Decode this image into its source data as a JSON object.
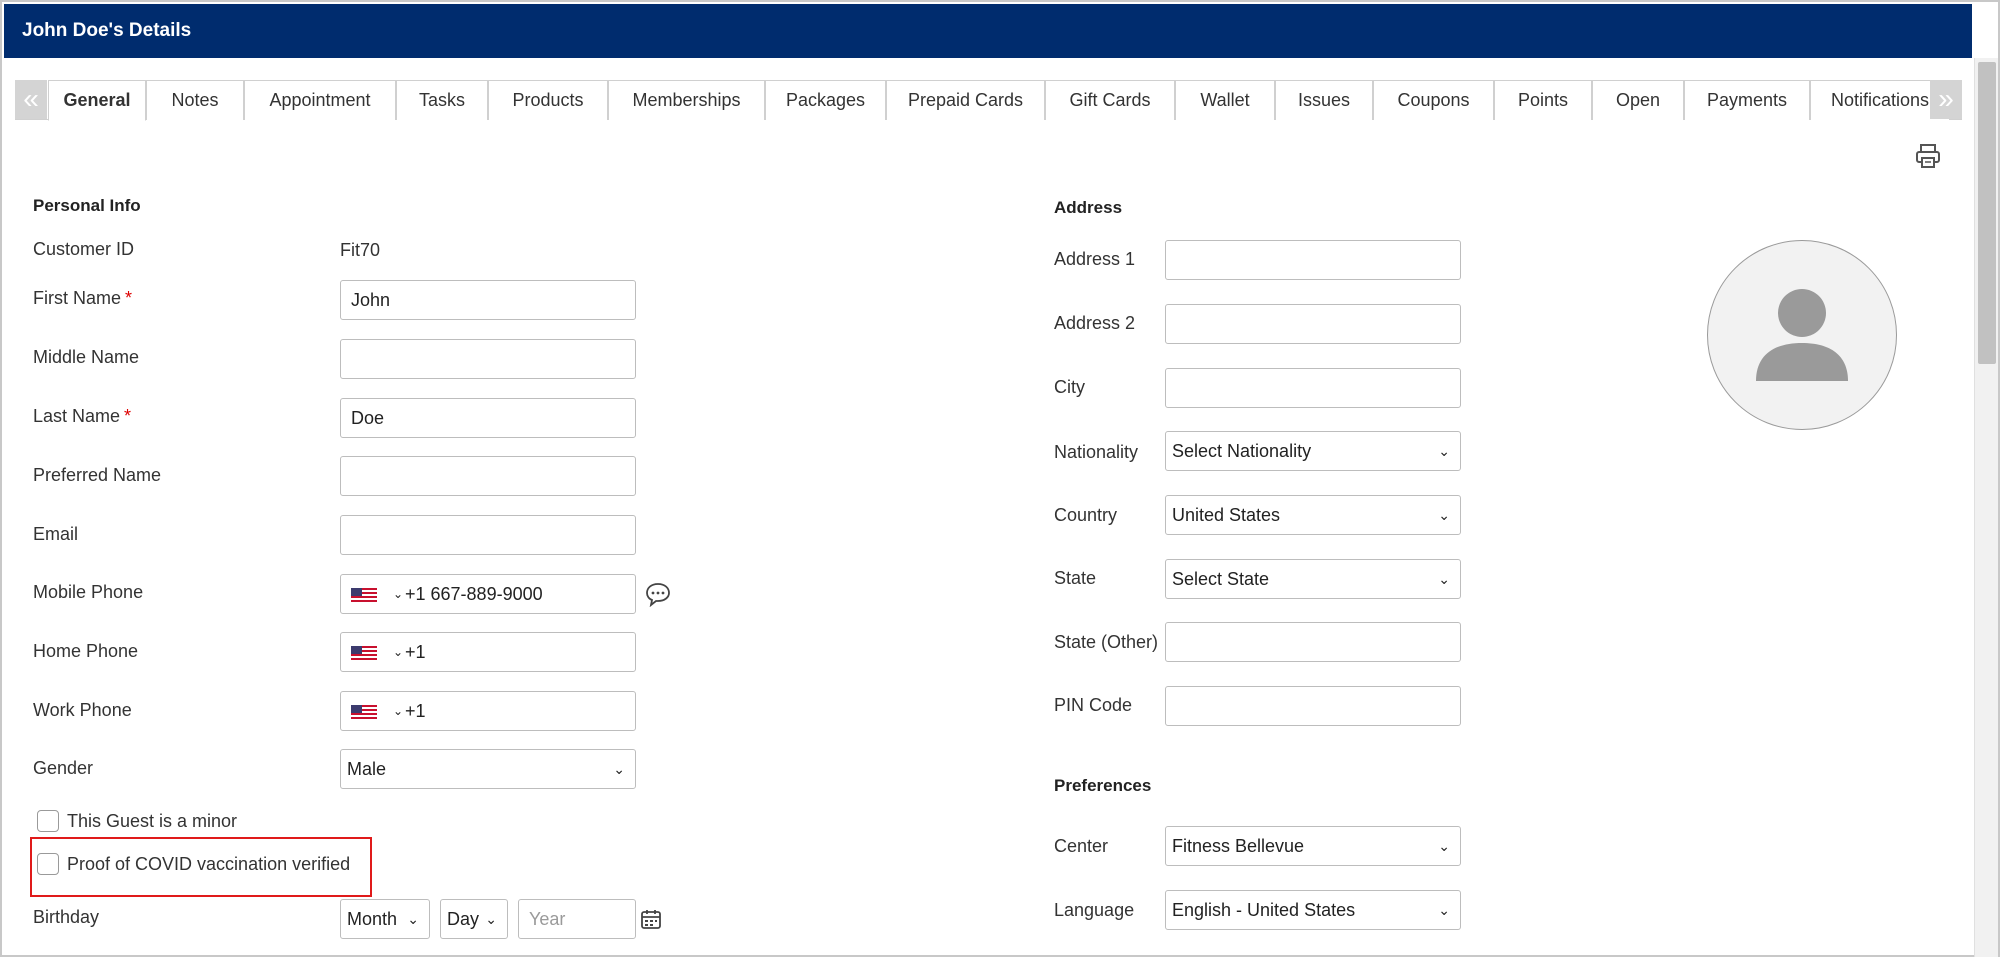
{
  "window": {
    "title": "John Doe's Details"
  },
  "tabs": [
    "General",
    "Notes",
    "Appointment",
    "Tasks",
    "Products",
    "Memberships",
    "Packages",
    "Prepaid Cards",
    "Gift Cards",
    "Wallet",
    "Issues",
    "Coupons",
    "Points",
    "Open",
    "Payments",
    "Notifications"
  ],
  "active_tab": "General",
  "personal": {
    "title": "Personal Info",
    "customer_id_label": "Customer ID",
    "customer_id": "Fit70",
    "first_name_label": "First Name",
    "first_name": "John",
    "middle_name_label": "Middle Name",
    "middle_name": "",
    "last_name_label": "Last Name",
    "last_name": "Doe",
    "preferred_name_label": "Preferred Name",
    "preferred_name": "",
    "email_label": "Email",
    "email": "",
    "mobile_label": "Mobile Phone",
    "mobile": "+1 667-889-9000",
    "home_label": "Home Phone",
    "home": "+1",
    "work_label": "Work Phone",
    "work": "+1",
    "gender_label": "Gender",
    "gender": "Male",
    "minor_label": "This Guest is a minor",
    "covid_label": "Proof of COVID vaccination verified",
    "birthday_label": "Birthday",
    "birthday_month": "Month",
    "birthday_day": "Day",
    "birthday_year_placeholder": "Year",
    "required_mark": "*"
  },
  "address": {
    "title": "Address",
    "address1_label": "Address 1",
    "address2_label": "Address 2",
    "city_label": "City",
    "nationality_label": "Nationality",
    "nationality": "Select Nationality",
    "country_label": "Country",
    "country": "United States",
    "state_label": "State",
    "state": "Select State",
    "state_other_label": "State (Other)",
    "pin_label": "PIN Code"
  },
  "preferences": {
    "title": "Preferences",
    "center_label": "Center",
    "center": "Fitness Bellevue",
    "language_label": "Language",
    "language": "English - United States"
  },
  "colors": {
    "titlebar": "#002c6e",
    "highlight": "#e01a1a",
    "required": "#d00000"
  },
  "icons": [
    "chevrons-left-icon",
    "chevrons-right-icon",
    "printer-icon",
    "us-flag-icon",
    "chat-bubble-icon",
    "calendar-icon",
    "avatar-icon"
  ]
}
